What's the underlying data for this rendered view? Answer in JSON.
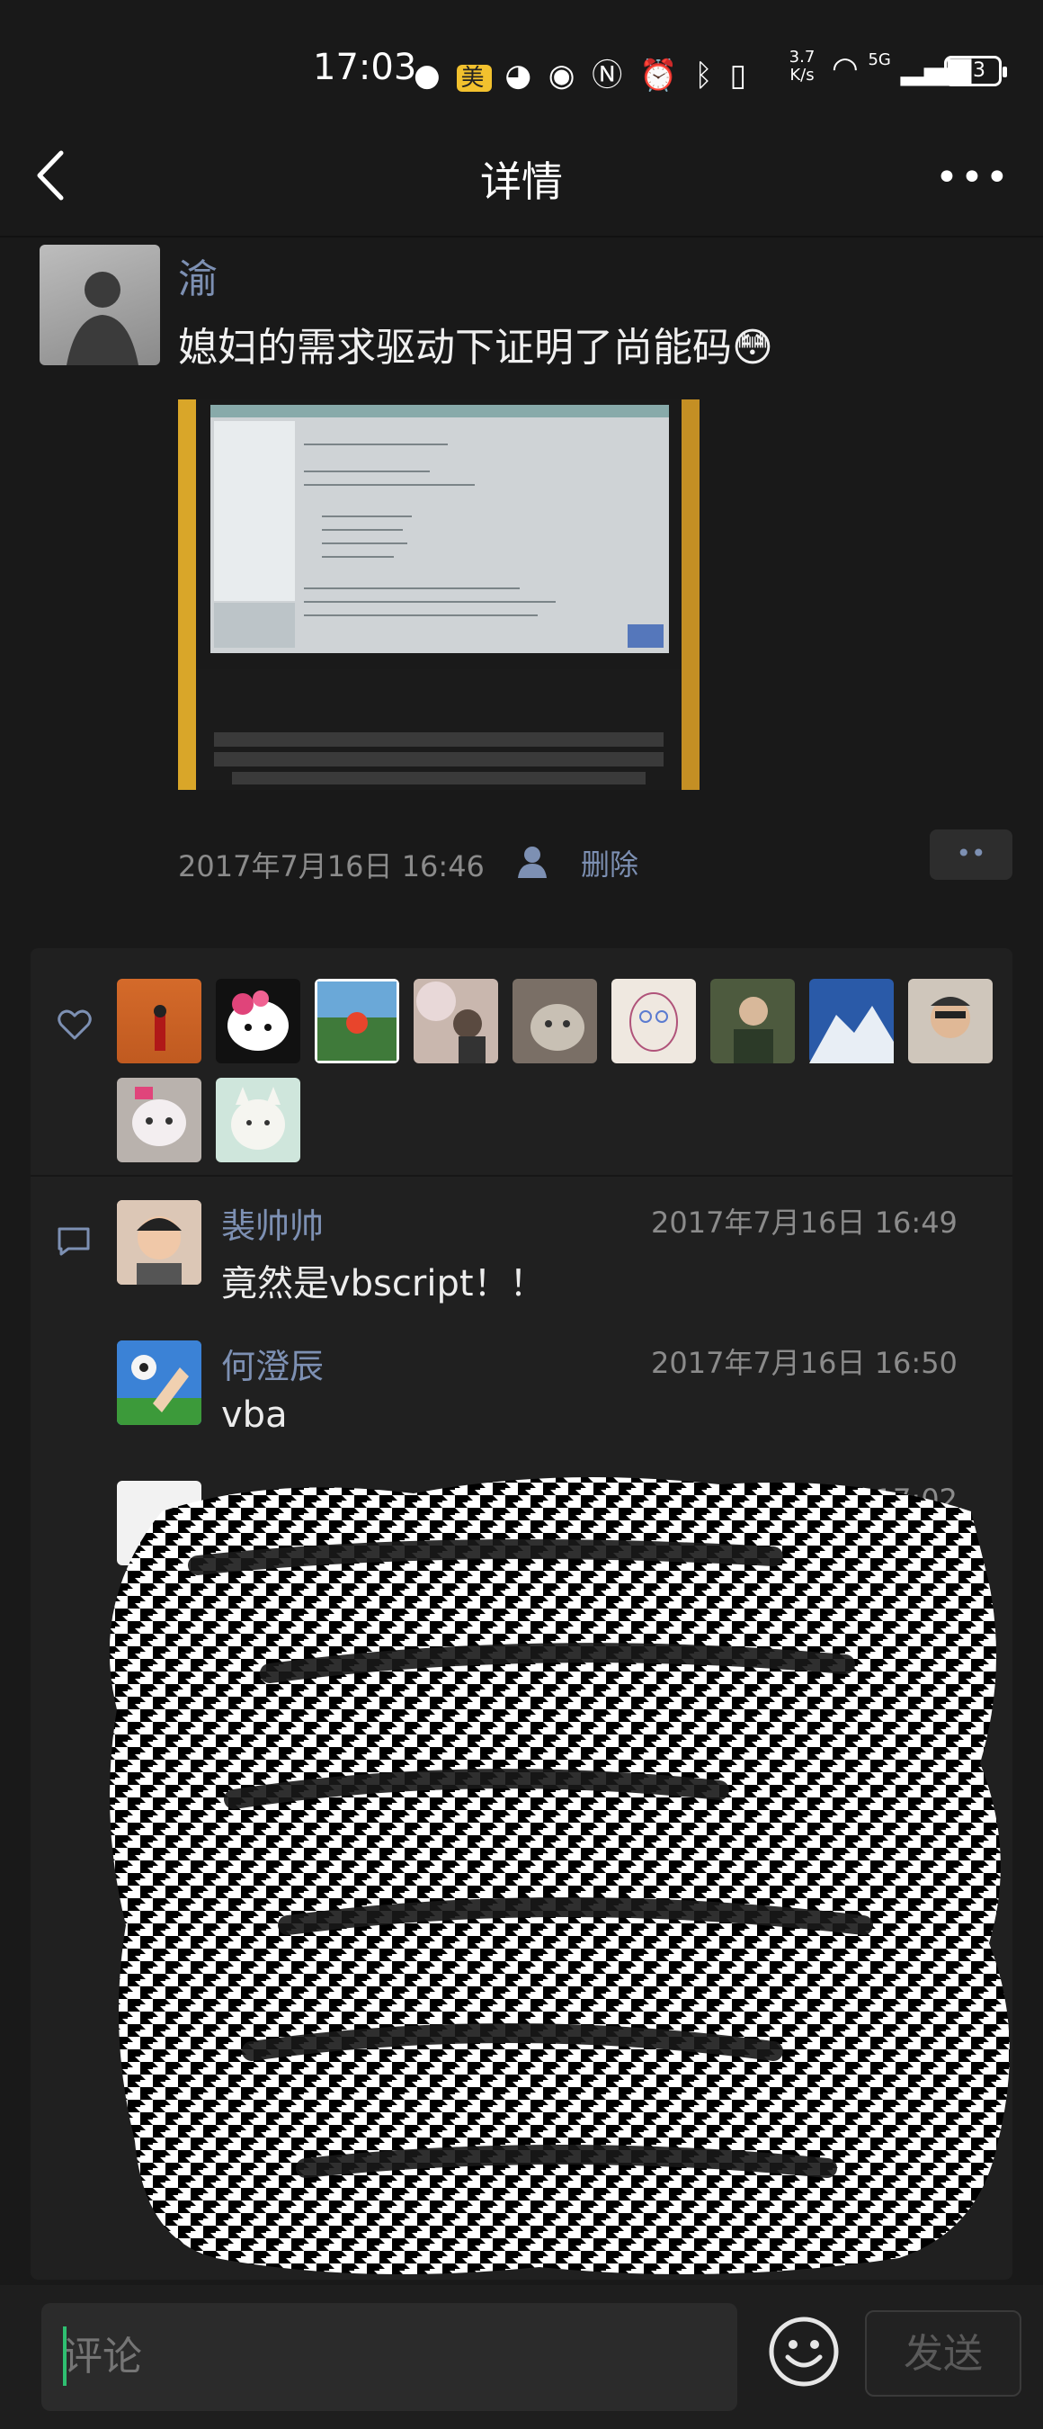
{
  "status_bar": {
    "time": "17:03",
    "speed_value": "3.7",
    "speed_unit": "K/s",
    "network": "5G",
    "battery": "53"
  },
  "nav": {
    "title": "详情",
    "more": "•••"
  },
  "post": {
    "author": "渝",
    "text": "媳妇的需求驱动下证明了尚能码😳",
    "timestamp": "2017年7月16日 16:46",
    "delete_label": "删除",
    "more_label": "••"
  },
  "likes": {
    "avatars": [
      "orange-wall-person",
      "hello-kitty",
      "person-framed",
      "cherry-blossom-person",
      "cat",
      "cartoon-face",
      "elder-person",
      "snow-mountain",
      "glasses-man",
      "plush-toy",
      "cartoon-cat"
    ]
  },
  "comments": [
    {
      "name": "裴帅帅",
      "time": "2017年7月16日 16:49",
      "text": "竟然是vbscript！！"
    },
    {
      "name": "何澄辰",
      "time": "2017年7月16日 16:50",
      "text": "vba"
    },
    {
      "name": "",
      "time": "2017年7月16日 17:02",
      "text": ""
    }
  ],
  "input": {
    "placeholder": "评论",
    "send_label": "发送"
  },
  "colors": {
    "background": "#191919",
    "link_blue": "#7d90b3",
    "cursor_green": "#2fbf71"
  }
}
